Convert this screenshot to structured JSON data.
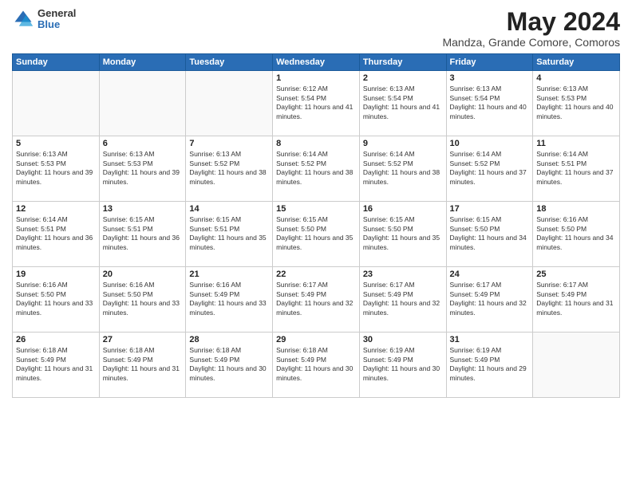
{
  "header": {
    "logo_line1": "General",
    "logo_line2": "Blue",
    "month": "May 2024",
    "location": "Mandza, Grande Comore, Comoros"
  },
  "weekdays": [
    "Sunday",
    "Monday",
    "Tuesday",
    "Wednesday",
    "Thursday",
    "Friday",
    "Saturday"
  ],
  "weeks": [
    [
      {
        "day": "",
        "info": ""
      },
      {
        "day": "",
        "info": ""
      },
      {
        "day": "",
        "info": ""
      },
      {
        "day": "1",
        "info": "Sunrise: 6:12 AM\nSunset: 5:54 PM\nDaylight: 11 hours and 41 minutes."
      },
      {
        "day": "2",
        "info": "Sunrise: 6:13 AM\nSunset: 5:54 PM\nDaylight: 11 hours and 41 minutes."
      },
      {
        "day": "3",
        "info": "Sunrise: 6:13 AM\nSunset: 5:54 PM\nDaylight: 11 hours and 40 minutes."
      },
      {
        "day": "4",
        "info": "Sunrise: 6:13 AM\nSunset: 5:53 PM\nDaylight: 11 hours and 40 minutes."
      }
    ],
    [
      {
        "day": "5",
        "info": "Sunrise: 6:13 AM\nSunset: 5:53 PM\nDaylight: 11 hours and 39 minutes."
      },
      {
        "day": "6",
        "info": "Sunrise: 6:13 AM\nSunset: 5:53 PM\nDaylight: 11 hours and 39 minutes."
      },
      {
        "day": "7",
        "info": "Sunrise: 6:13 AM\nSunset: 5:52 PM\nDaylight: 11 hours and 38 minutes."
      },
      {
        "day": "8",
        "info": "Sunrise: 6:14 AM\nSunset: 5:52 PM\nDaylight: 11 hours and 38 minutes."
      },
      {
        "day": "9",
        "info": "Sunrise: 6:14 AM\nSunset: 5:52 PM\nDaylight: 11 hours and 38 minutes."
      },
      {
        "day": "10",
        "info": "Sunrise: 6:14 AM\nSunset: 5:52 PM\nDaylight: 11 hours and 37 minutes."
      },
      {
        "day": "11",
        "info": "Sunrise: 6:14 AM\nSunset: 5:51 PM\nDaylight: 11 hours and 37 minutes."
      }
    ],
    [
      {
        "day": "12",
        "info": "Sunrise: 6:14 AM\nSunset: 5:51 PM\nDaylight: 11 hours and 36 minutes."
      },
      {
        "day": "13",
        "info": "Sunrise: 6:15 AM\nSunset: 5:51 PM\nDaylight: 11 hours and 36 minutes."
      },
      {
        "day": "14",
        "info": "Sunrise: 6:15 AM\nSunset: 5:51 PM\nDaylight: 11 hours and 35 minutes."
      },
      {
        "day": "15",
        "info": "Sunrise: 6:15 AM\nSunset: 5:50 PM\nDaylight: 11 hours and 35 minutes."
      },
      {
        "day": "16",
        "info": "Sunrise: 6:15 AM\nSunset: 5:50 PM\nDaylight: 11 hours and 35 minutes."
      },
      {
        "day": "17",
        "info": "Sunrise: 6:15 AM\nSunset: 5:50 PM\nDaylight: 11 hours and 34 minutes."
      },
      {
        "day": "18",
        "info": "Sunrise: 6:16 AM\nSunset: 5:50 PM\nDaylight: 11 hours and 34 minutes."
      }
    ],
    [
      {
        "day": "19",
        "info": "Sunrise: 6:16 AM\nSunset: 5:50 PM\nDaylight: 11 hours and 33 minutes."
      },
      {
        "day": "20",
        "info": "Sunrise: 6:16 AM\nSunset: 5:50 PM\nDaylight: 11 hours and 33 minutes."
      },
      {
        "day": "21",
        "info": "Sunrise: 6:16 AM\nSunset: 5:49 PM\nDaylight: 11 hours and 33 minutes."
      },
      {
        "day": "22",
        "info": "Sunrise: 6:17 AM\nSunset: 5:49 PM\nDaylight: 11 hours and 32 minutes."
      },
      {
        "day": "23",
        "info": "Sunrise: 6:17 AM\nSunset: 5:49 PM\nDaylight: 11 hours and 32 minutes."
      },
      {
        "day": "24",
        "info": "Sunrise: 6:17 AM\nSunset: 5:49 PM\nDaylight: 11 hours and 32 minutes."
      },
      {
        "day": "25",
        "info": "Sunrise: 6:17 AM\nSunset: 5:49 PM\nDaylight: 11 hours and 31 minutes."
      }
    ],
    [
      {
        "day": "26",
        "info": "Sunrise: 6:18 AM\nSunset: 5:49 PM\nDaylight: 11 hours and 31 minutes."
      },
      {
        "day": "27",
        "info": "Sunrise: 6:18 AM\nSunset: 5:49 PM\nDaylight: 11 hours and 31 minutes."
      },
      {
        "day": "28",
        "info": "Sunrise: 6:18 AM\nSunset: 5:49 PM\nDaylight: 11 hours and 30 minutes."
      },
      {
        "day": "29",
        "info": "Sunrise: 6:18 AM\nSunset: 5:49 PM\nDaylight: 11 hours and 30 minutes."
      },
      {
        "day": "30",
        "info": "Sunrise: 6:19 AM\nSunset: 5:49 PM\nDaylight: 11 hours and 30 minutes."
      },
      {
        "day": "31",
        "info": "Sunrise: 6:19 AM\nSunset: 5:49 PM\nDaylight: 11 hours and 29 minutes."
      },
      {
        "day": "",
        "info": ""
      }
    ]
  ]
}
